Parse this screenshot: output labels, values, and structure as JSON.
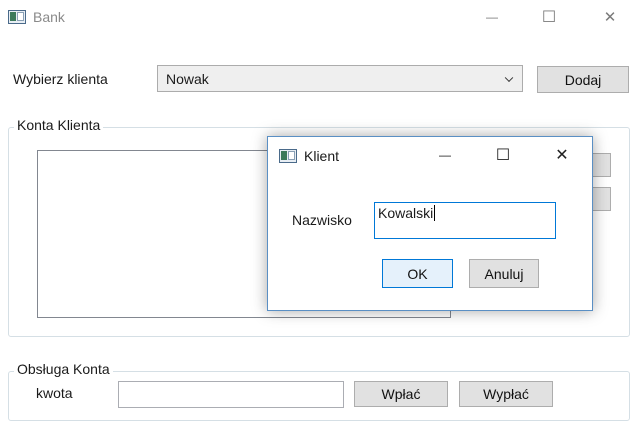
{
  "window": {
    "title": "Bank",
    "minimize_glyph": "—",
    "maximize_glyph": "☐",
    "close_glyph": "✕"
  },
  "client_select": {
    "label": "Wybierz klienta",
    "selected": "Nowak",
    "add_button": "Dodaj"
  },
  "accounts_group": {
    "title": "Konta Klienta"
  },
  "operations_group": {
    "title": "Obsługa Konta",
    "amount_label": "kwota",
    "amount_value": "",
    "deposit_button": "Wpłać",
    "withdraw_button": "Wypłać"
  },
  "dialog": {
    "title": "Klient",
    "minimize_glyph": "—",
    "maximize_glyph": "☐",
    "close_glyph": "✕",
    "surname_label": "Nazwisko",
    "surname_value": "Kowalski",
    "ok_button": "OK",
    "cancel_button": "Anuluj"
  }
}
